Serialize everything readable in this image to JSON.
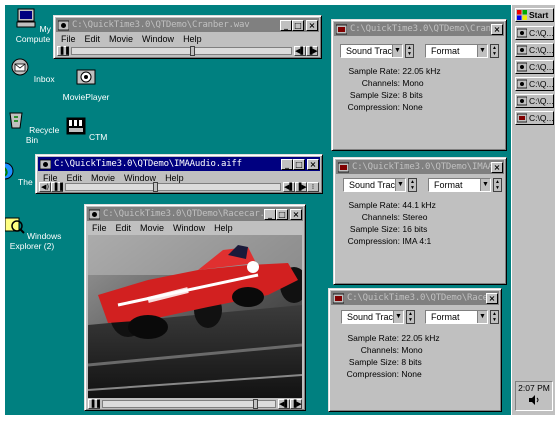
{
  "desktop": {
    "icons": [
      {
        "label": "My Compute"
      },
      {
        "label": "Inbox"
      },
      {
        "label": "Recycle Bin"
      },
      {
        "label": "The In"
      },
      {
        "label": "Windows Explorer (2)"
      },
      {
        "label": "MoviePlayer"
      },
      {
        "label": "CTM"
      }
    ]
  },
  "menu": [
    "File",
    "Edit",
    "Movie",
    "Window",
    "Help"
  ],
  "players": [
    {
      "title": "C:\\QuickTime3.0\\QTDemo\\Cranber.wav"
    },
    {
      "title": "C:\\QuickTime3.0\\QTDemo\\IMAAudio.aiff"
    },
    {
      "title": "C:\\QuickTime3.0\\QTDemo\\Racecar.avi"
    }
  ],
  "info_panels": [
    {
      "title": "C:\\QuickTime3.0\\QTDemo\\Cranb...",
      "track": "Sound Track",
      "format": "Format",
      "rows": [
        {
          "label": "Sample Rate:",
          "value": "22.05  kHz"
        },
        {
          "label": "Channels:",
          "value": "Mono"
        },
        {
          "label": "Sample Size:",
          "value": "8 bits"
        },
        {
          "label": "Compression:",
          "value": "None"
        }
      ]
    },
    {
      "title": "C:\\QuickTime3.0\\QTDemo\\IMAAu...",
      "track": "Sound Track",
      "format": "Format",
      "rows": [
        {
          "label": "Sample Rate:",
          "value": "44.1  kHz"
        },
        {
          "label": "Channels:",
          "value": "Stereo"
        },
        {
          "label": "Sample Size:",
          "value": "16 bits"
        },
        {
          "label": "Compression:",
          "value": "IMA 4:1"
        }
      ]
    },
    {
      "title": "C:\\QuickTime3.0\\QTDemo\\Racec...",
      "track": "Sound Track",
      "format": "Format",
      "rows": [
        {
          "label": "Sample Rate:",
          "value": "22.05  kHz"
        },
        {
          "label": "Channels:",
          "value": "Mono"
        },
        {
          "label": "Sample Size:",
          "value": "8 bits"
        },
        {
          "label": "Compression:",
          "value": "None"
        }
      ]
    }
  ],
  "taskbar": {
    "start": "Start",
    "buttons": [
      "C:\\Q...",
      "C:\\Q...",
      "C:\\Q...",
      "C:\\Q...",
      "C:\\Q...",
      "C:\\Q..."
    ],
    "clock": "2:07 PM"
  },
  "colors": {
    "desktop": "#008080",
    "active_title": "#000080",
    "inactive_title": "#808080",
    "face": "#c0c0c0"
  }
}
